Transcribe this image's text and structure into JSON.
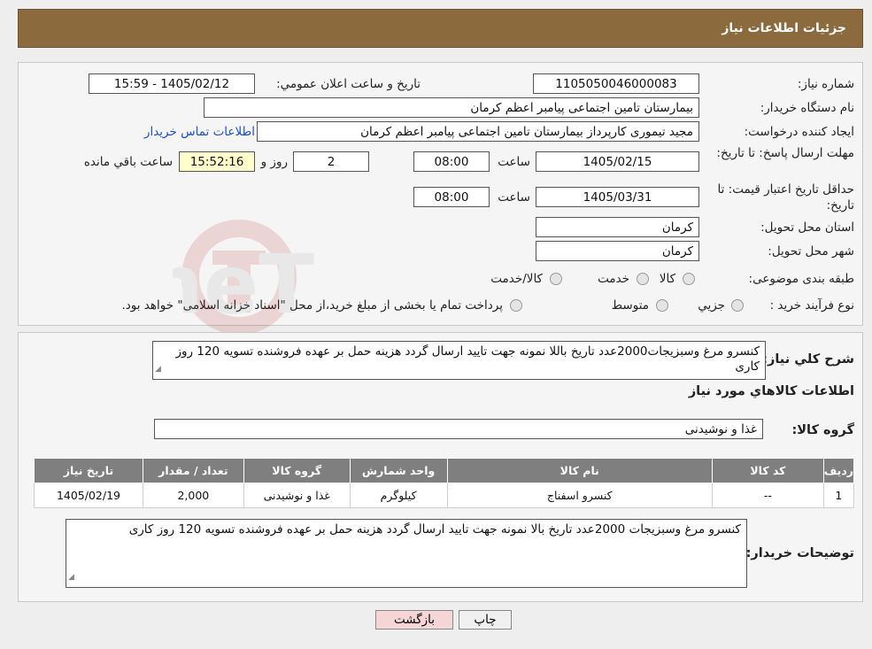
{
  "header": {
    "title": "جزئیات اطلاعات نیاز"
  },
  "form": {
    "need_number": {
      "label": "شماره نیاز:",
      "value": "1105050046000083"
    },
    "announce_date": {
      "label": "تاریخ و ساعت اعلان عمومي:",
      "value": "1405/02/12 - 15:59"
    },
    "buyer_org": {
      "label": "نام دستگاه خریدار:",
      "value": "بیمارستان تامین اجتماعی پیامبر اعظم کرمان"
    },
    "requester": {
      "label": "ایجاد کننده درخواست:",
      "value": "مجید تیموری کارپرداز بیمارستان تامین اجتماعی پیامبر اعظم کرمان",
      "contact_link": "اطلاعات تماس خریدار"
    },
    "reply_deadline": {
      "label": "مهلت ارسال پاسخ: تا تاریخ:",
      "date": "1405/02/15",
      "time_label": "ساعت",
      "time": "08:00",
      "days": "2",
      "days_label": "روز و",
      "remaining": "15:52:16",
      "remaining_label": "ساعت باقي مانده"
    },
    "price_validity": {
      "label": "حداقل تاریخ اعتبار قیمت: تا تاریخ:",
      "date": "1405/03/31",
      "time_label": "ساعت",
      "time": "08:00"
    },
    "province": {
      "label": "استان محل تحویل:",
      "value": "کرمان"
    },
    "city": {
      "label": "شهر محل تحویل:",
      "value": "کرمان"
    },
    "category": {
      "label": "طبقه بندی موضوعی:",
      "options": [
        "کالا",
        "خدمت",
        "کالا/خدمت"
      ]
    },
    "process": {
      "label": "نوع فرآیند خرید :",
      "options": [
        "جزیي",
        "متوسط"
      ],
      "note": "پرداخت تمام یا بخشی از مبلغ خرید،از محل \"اسناد خزانه اسلامی\" خواهد بود."
    }
  },
  "details": {
    "summary_label": "شرح کلي نیاز:",
    "summary": "کنسرو مرغ وسبزیجات2000عدد  تاریخ باللا نمونه جهت تایید ارسال گردد هزینه حمل بر عهده فروشنده تسویه 120 روز کاری",
    "goods_title": "اطلاعات کالاهاي مورد نیاز",
    "group_label": "گروه کالا:",
    "group_value": "غذا و نوشیدنی"
  },
  "table": {
    "headers": [
      "ردیف",
      "کد کالا",
      "نام کالا",
      "واحد شمارش",
      "گروه کالا",
      "تعداد / مقدار",
      "تاریخ نیاز"
    ],
    "rows": [
      [
        "1",
        "--",
        "کنسرو اسفناج",
        "کیلوگرم",
        "غذا و نوشیدنی",
        "2,000",
        "1405/02/19"
      ]
    ]
  },
  "buyer_notes": {
    "label": "توضیحات خریدار:",
    "text": "کنسرو مرغ وسبزیجات 2000عدد تاریخ بالا نمونه جهت تایید ارسال گردد هزینه حمل بر عهده فروشنده تسویه 120 روز کاری"
  },
  "buttons": {
    "print": "چاپ",
    "back": "بازگشت"
  },
  "watermark": {
    "text": "AriaTender.neT"
  },
  "colors": {
    "header": "#8b6a3d",
    "back_button": "#f5d5d5",
    "table_header": "#7f7f7f",
    "link": "#1a4fcf"
  }
}
